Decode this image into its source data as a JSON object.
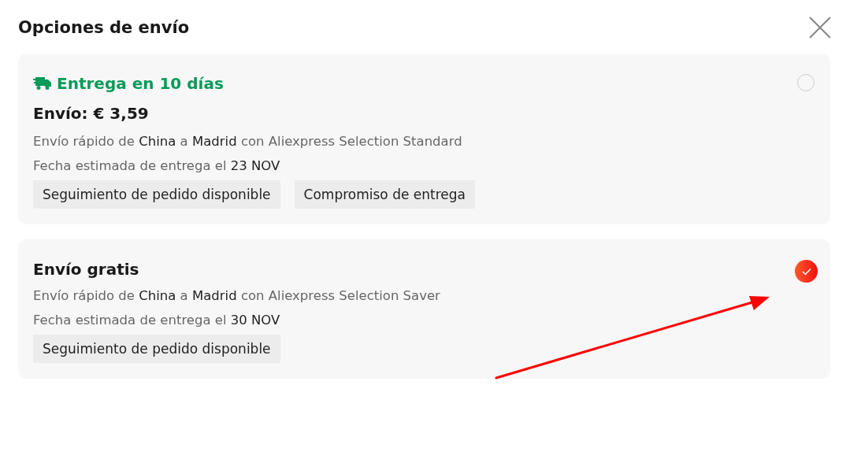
{
  "dialog": {
    "title": "Opciones de envío"
  },
  "options": [
    {
      "kind": "express",
      "headline": "Entrega en 10 días",
      "price": "Envío: € 3,59",
      "route": "Envío rápido de **China** a **Madrid** con Aliexpress Selection Standard",
      "estimate": "Fecha estimada de entrega el **23 NOV**",
      "tags": [
        "Seguimiento de pedido disponible",
        "Compromiso de entrega"
      ],
      "selected": false
    },
    {
      "kind": "plain",
      "headline": "Envío gratis",
      "route": "Envío rápido de **China** a **Madrid** con Aliexpress Selection Saver",
      "estimate": "Fecha estimada de entrega el **30 NOV**",
      "tags": [
        "Seguimiento de pedido disponible"
      ],
      "selected": true
    }
  ]
}
